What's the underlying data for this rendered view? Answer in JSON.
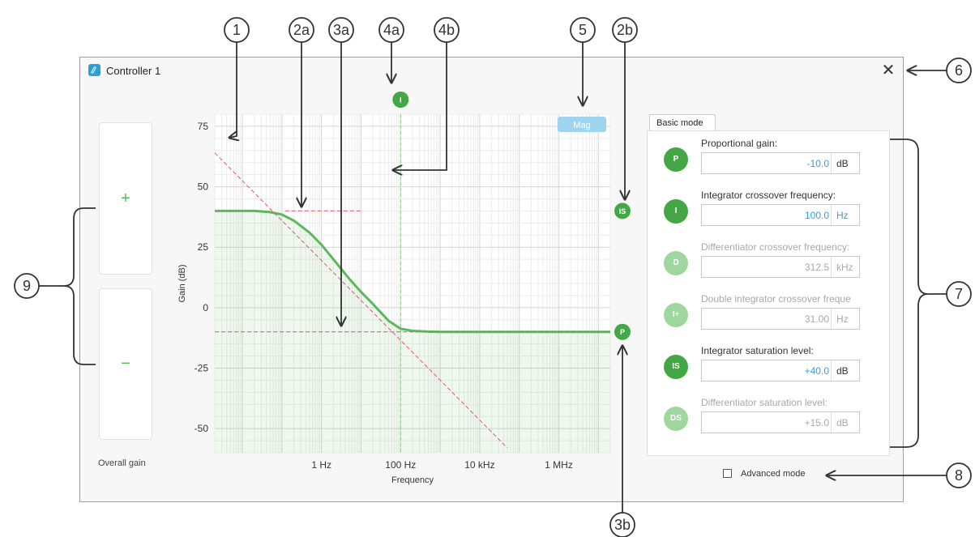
{
  "window": {
    "title": "Controller 1",
    "close_glyph": "✕"
  },
  "overall_gain": {
    "plus_label": "+",
    "minus_label": "−",
    "label": "Overall gain"
  },
  "plot": {
    "toggle_label": "Mag",
    "integrator_marker": "I",
    "sat_marker": "IS",
    "p_marker": "P"
  },
  "chart_data": {
    "type": "line",
    "xlabel": "Frequency",
    "ylabel": "Gain (dB)",
    "x_scale": "log",
    "xlim_hz": [
      0.002,
      20000000
    ],
    "ylim": [
      -60,
      80
    ],
    "yticks": [
      75,
      50,
      25,
      0,
      -25,
      -50
    ],
    "ytick_labels": [
      "75",
      "50",
      "25",
      "0",
      "-25",
      "-50"
    ],
    "xticks_hz": [
      1,
      100,
      10000,
      1000000
    ],
    "xtick_labels": [
      "1 Hz",
      "100 Hz",
      "10 kHz",
      "1 MHz"
    ],
    "grid": true,
    "series": [
      {
        "role": "response",
        "color": "#5cb85c",
        "x_hz": [
          0.002,
          0.02,
          0.05,
          0.1,
          0.2,
          0.5,
          1,
          2,
          5,
          10,
          20,
          50,
          100,
          200,
          500,
          1000,
          10000,
          100000,
          1000000,
          20000000
        ],
        "y_db": [
          40,
          40,
          39.5,
          38.5,
          36,
          31,
          26,
          20,
          12,
          6.5,
          1.5,
          -5.5,
          -8.7,
          -9.6,
          -9.9,
          -10,
          -10,
          -10,
          -10,
          -10
        ]
      },
      {
        "role": "integrator_asymptote",
        "color": "#e05a6a",
        "x_hz": [
          0.002,
          50000
        ],
        "y_db": [
          64,
          -58
        ]
      },
      {
        "role": "saturation_level",
        "color": "#e05a6a",
        "x_hz": [
          0.12,
          10
        ],
        "y_db": [
          40,
          40
        ]
      },
      {
        "role": "proportional_level",
        "color": "#e05a6a",
        "x_hz": [
          0.002,
          20000000
        ],
        "y_db": [
          -10,
          -10
        ]
      }
    ],
    "markers": [
      {
        "label": "IS",
        "y_db": 40
      },
      {
        "label": "P",
        "y_db": -10
      }
    ],
    "crossover_hz": 100
  },
  "tab": {
    "label": "Basic mode"
  },
  "params": [
    {
      "badge": "P",
      "label": "Proportional gain:",
      "value": "-10.0",
      "unit": "dB",
      "active": true,
      "badge_color": "#43a843"
    },
    {
      "badge": "I",
      "label": "Integrator crossover frequency:",
      "value": "100.0",
      "unit": "Hz",
      "active": true,
      "badge_color": "#43a843"
    },
    {
      "badge": "D",
      "label": "Differentiator crossover frequency:",
      "value": "312.5",
      "unit": "kHz",
      "active": false,
      "badge_color": "#9fd89f"
    },
    {
      "badge": "I+",
      "label": "Double integrator crossover freque",
      "value": "31.00",
      "unit": "Hz",
      "active": false,
      "badge_color": "#9fd89f"
    },
    {
      "badge": "IS",
      "label": "Integrator saturation level:",
      "value": "+40.0",
      "unit": "dB",
      "active": true,
      "badge_color": "#43a843"
    },
    {
      "badge": "DS",
      "label": "Differentiator saturation level:",
      "value": "+15.0",
      "unit": "dB",
      "active": false,
      "badge_color": "#9fd89f"
    }
  ],
  "advanced": {
    "label": "Advanced mode",
    "checked": false
  },
  "callouts": [
    {
      "label": "1"
    },
    {
      "label": "2a"
    },
    {
      "label": "3a"
    },
    {
      "label": "4a"
    },
    {
      "label": "4b"
    },
    {
      "label": "5"
    },
    {
      "label": "2b"
    },
    {
      "label": "6"
    },
    {
      "label": "7"
    },
    {
      "label": "8"
    },
    {
      "label": "9"
    },
    {
      "label": "3b"
    }
  ],
  "colors": {
    "accent_green": "#43a843",
    "light_green": "#9fd89f",
    "value_blue": "#29a3e0",
    "disabled_gray": "#a8a8a8",
    "asymptote_red": "#e05a6a",
    "mag_button": "#9fd4f1"
  }
}
